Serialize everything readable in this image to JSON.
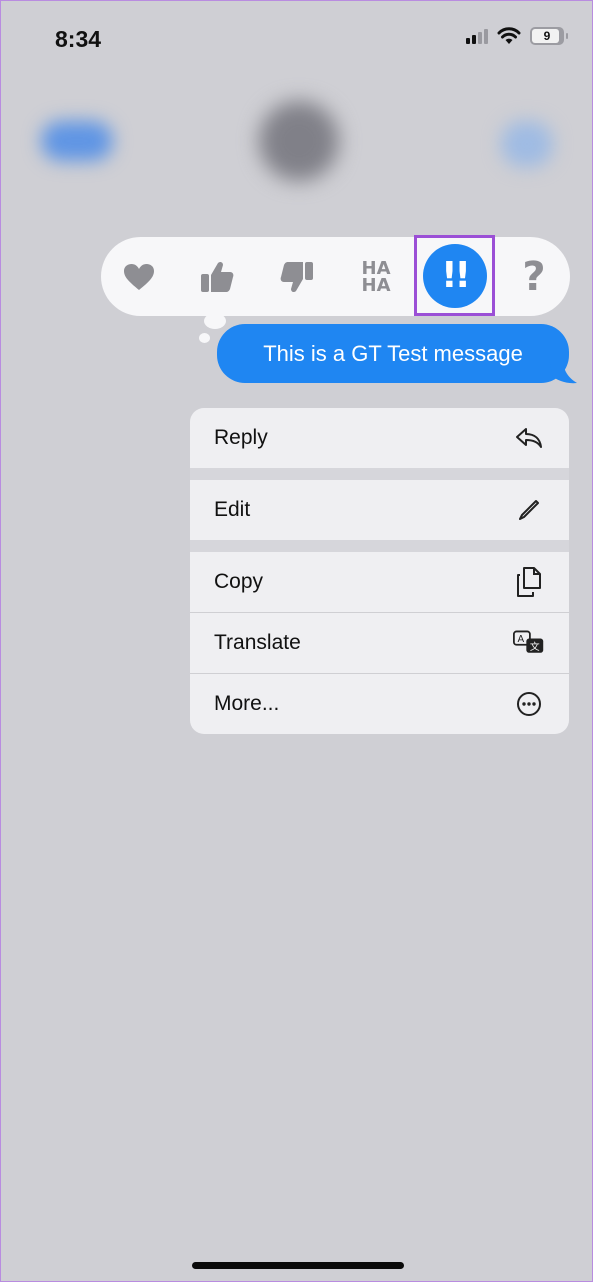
{
  "status_bar": {
    "time": "8:34",
    "battery_level": "9",
    "icons": [
      "signal-icon",
      "wifi-icon",
      "battery-icon"
    ]
  },
  "tapbacks": {
    "items": [
      {
        "name": "heart",
        "icon": "heart-icon"
      },
      {
        "name": "thumbs-up",
        "icon": "thumbs-up-icon"
      },
      {
        "name": "thumbs-down",
        "icon": "thumbs-down-icon"
      },
      {
        "name": "haha",
        "icon": "haha-icon",
        "label_line1": "HA",
        "label_line2": "HA"
      },
      {
        "name": "emphasize",
        "icon": "double-exclamation-icon",
        "label": "!!",
        "selected": true
      },
      {
        "name": "question",
        "icon": "question-icon",
        "label": "?"
      }
    ],
    "highlight_color": "#9b4fd6",
    "selected_color": "#1f86f2"
  },
  "message": {
    "text": "This is a GT Test message",
    "bubble_color": "#1f86f2"
  },
  "context_menu": {
    "items": [
      {
        "label": "Reply",
        "icon": "reply-arrow-icon"
      },
      {
        "label": "Edit",
        "icon": "pencil-icon"
      },
      {
        "label": "Copy",
        "icon": "copy-documents-icon"
      },
      {
        "label": "Translate",
        "icon": "translate-icon"
      },
      {
        "label": "More...",
        "icon": "more-ellipsis-icon"
      }
    ]
  }
}
